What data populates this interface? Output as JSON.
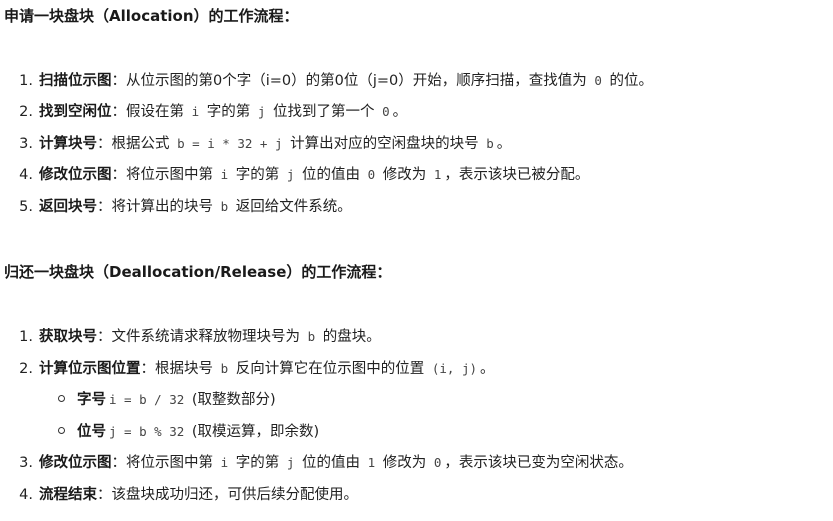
{
  "section1": {
    "title": "申请一块盘块（Allocation）的工作流程：",
    "steps": [
      {
        "num": "1.",
        "label": "扫描位示图",
        "t1": "：从位示图的第0个字（i=0）的第0位（j=0）开始，顺序扫描，查找值为 ",
        "c1": "0",
        "t2": " 的位。"
      },
      {
        "num": "2.",
        "label": "找到空闲位",
        "t1": "：假设在第 ",
        "c1": "i",
        "t2": " 字的第 ",
        "c2": "j",
        "t3": " 位找到了第一个 ",
        "c3": "0",
        "t4": "。"
      },
      {
        "num": "3.",
        "label": "计算块号",
        "t1": "：根据公式 ",
        "c1": "b = i * 32 + j",
        "t2": " 计算出对应的空闲盘块的块号 ",
        "c2": "b",
        "t3": "。"
      },
      {
        "num": "4.",
        "label": "修改位示图",
        "t1": "：将位示图中第 ",
        "c1": "i",
        "t2": " 字的第 ",
        "c2": "j",
        "t3": " 位的值由 ",
        "c3": "0",
        "t4": " 修改为 ",
        "c4": "1",
        "t5": "，表示该块已被分配。"
      },
      {
        "num": "5.",
        "label": "返回块号",
        "t1": "：将计算出的块号 ",
        "c1": "b",
        "t2": " 返回给文件系统。"
      }
    ]
  },
  "section2": {
    "title": "归还一块盘块（Deallocation/Release）的工作流程：",
    "steps": [
      {
        "num": "1.",
        "label": "获取块号",
        "t1": "：文件系统请求释放物理块号为 ",
        "c1": "b",
        "t2": " 的盘块。"
      },
      {
        "num": "2.",
        "label": "计算位示图位置",
        "t1": "：根据块号 ",
        "c1": "b",
        "t2": " 反向计算它在位示图中的位置 ",
        "c2": "(i, j)",
        "t3": "。"
      },
      {
        "num": "3.",
        "label": "修改位示图",
        "t1": "：将位示图中第 ",
        "c1": "i",
        "t2": " 字的第 ",
        "c2": "j",
        "t3": " 位的值由 ",
        "c3": "1",
        "t4": " 修改为 ",
        "c4": "0",
        "t5": "，表示该块已变为空闲状态。"
      },
      {
        "num": "4.",
        "label": "流程结束",
        "t1": "：该盘块成功归还，可供后续分配使用。"
      }
    ],
    "substeps": [
      {
        "label": "字号",
        "c1": "i = b / 32",
        "t1": " (取整数部分)"
      },
      {
        "label": "位号",
        "c1": "j = b % 32",
        "t1": " (取模运算，即余数)"
      }
    ]
  }
}
